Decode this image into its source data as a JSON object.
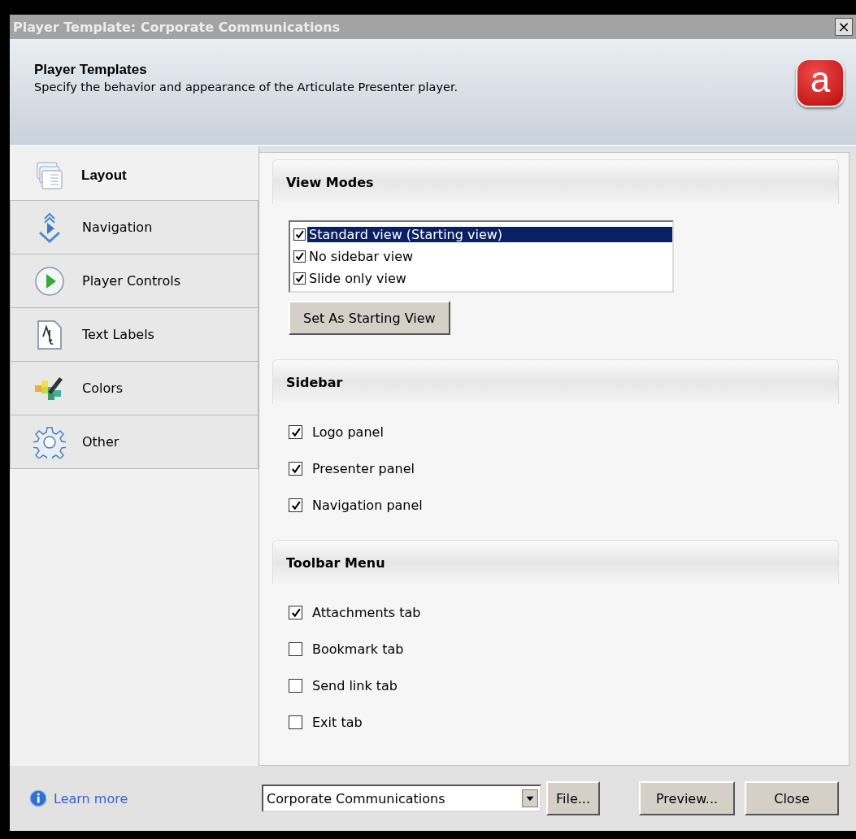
{
  "window": {
    "title": "Player Template: Corporate Communications",
    "close": "×"
  },
  "header": {
    "title": "Player Templates",
    "description": "Specify the behavior and appearance of the Articulate Presenter player.",
    "logo": "a"
  },
  "sidebar": {
    "items": [
      {
        "label": "Layout",
        "kind": "layout",
        "selected": true
      },
      {
        "label": "Navigation",
        "kind": "navigation",
        "selected": false
      },
      {
        "label": "Player Controls",
        "kind": "play",
        "selected": false
      },
      {
        "label": "Text Labels",
        "kind": "text",
        "selected": false
      },
      {
        "label": "Colors",
        "kind": "colors",
        "selected": false
      },
      {
        "label": "Other",
        "kind": "gear",
        "selected": false
      }
    ]
  },
  "sections": [
    {
      "title": "View Modes",
      "kind": "listbox",
      "items": [
        {
          "label": "Standard view (Starting view)",
          "checked": true,
          "selected": true
        },
        {
          "label": "No sidebar view",
          "checked": true,
          "selected": false
        },
        {
          "label": "Slide only view",
          "checked": true,
          "selected": false
        }
      ],
      "button": "Set As Starting View"
    },
    {
      "title": "Sidebar",
      "kind": "checkboxes",
      "items": [
        {
          "label": "Logo panel",
          "checked": true
        },
        {
          "label": "Presenter panel",
          "checked": true
        },
        {
          "label": "Navigation panel",
          "checked": true
        }
      ]
    },
    {
      "title": "Toolbar Menu",
      "kind": "checkboxes",
      "items": [
        {
          "label": "Attachments tab",
          "checked": true
        },
        {
          "label": "Bookmark tab",
          "checked": false
        },
        {
          "label": "Send link tab",
          "checked": false
        },
        {
          "label": "Exit tab",
          "checked": false
        }
      ]
    }
  ],
  "footer": {
    "learn_more": "Learn more",
    "template": "Corporate Communications",
    "buttons": [
      "File...",
      "Preview...",
      "Close"
    ]
  }
}
